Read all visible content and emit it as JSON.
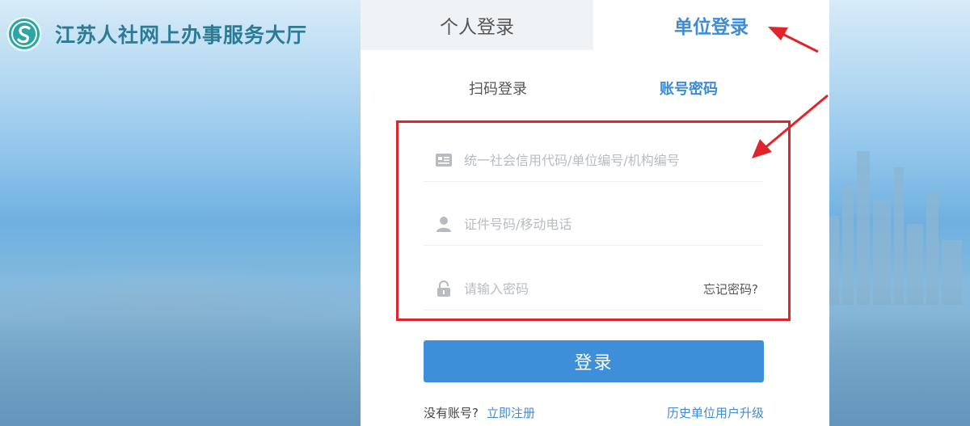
{
  "brand": {
    "title": "江苏人社网上办事服务大厅",
    "logo_icon": "hrss-logo"
  },
  "tabs": {
    "personal": "个人登录",
    "company": "单位登录",
    "active": "company"
  },
  "subtabs": {
    "qr": "扫码登录",
    "account": "账号密码",
    "active": "account"
  },
  "form": {
    "org_code": {
      "placeholder": "统一社会信用代码/单位编号/机构编号",
      "value": "",
      "icon": "id-card-icon"
    },
    "id_phone": {
      "placeholder": "证件号码/移动电话",
      "value": "",
      "icon": "user-icon"
    },
    "password": {
      "placeholder": "请输入密码",
      "value": "",
      "icon": "lock-icon"
    },
    "forgot_label": "忘记密码?"
  },
  "login_label": "登录",
  "footer": {
    "no_account": "没有账号?",
    "register": "立即注册",
    "upgrade": "历史单位用户升级"
  },
  "colors": {
    "accent": "#3e8cd8",
    "button": "#3d8fd9",
    "annotation": "#e0252a",
    "brand_text": "#2b7a96"
  }
}
